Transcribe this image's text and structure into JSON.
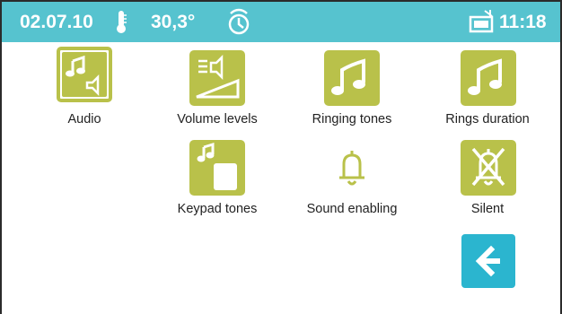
{
  "statusbar": {
    "date": "02.07.10",
    "temperature": "30,3°",
    "time": "11:18",
    "thermometer_icon": "thermometer-icon",
    "clock_icon": "alarm-clock-icon",
    "mail_icon": "envelope-icon"
  },
  "menu": {
    "items": [
      {
        "label": "Audio",
        "icon": "audio-icon",
        "selected": true
      },
      {
        "label": "Volume levels",
        "icon": "volume-levels-icon"
      },
      {
        "label": "Ringing tones",
        "icon": "music-note-icon"
      },
      {
        "label": "Rings duration",
        "icon": "music-note-icon"
      },
      {
        "label": "Keypad tones",
        "icon": "keypad-tones-icon"
      },
      {
        "label": "Sound enabling",
        "icon": "bell-icon"
      },
      {
        "label": "Silent",
        "icon": "muted-bell-icon"
      }
    ],
    "back_icon": "back-arrow-icon"
  },
  "colors": {
    "statusbar": "#56c3cf",
    "tile": "#b9c14a",
    "back_button": "#2bb5cf"
  }
}
